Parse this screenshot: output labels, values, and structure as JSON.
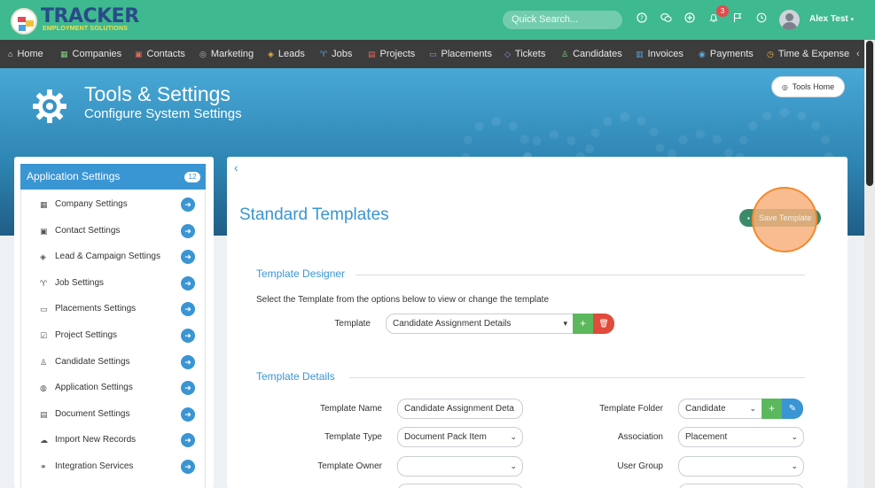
{
  "topbar": {
    "logo_text": "TRACKER",
    "logo_sub": "EMPLOYMENT SOLUTIONS",
    "search_placeholder": "Quick Search...",
    "notification_count": "3",
    "username": "Alex Test",
    "icons": [
      "help-icon",
      "chat-icon",
      "plus-circle-icon",
      "bell-icon",
      "flag-icon",
      "history-icon"
    ]
  },
  "nav": {
    "items": [
      {
        "label": "Home",
        "icon": "home-icon"
      },
      {
        "label": "Companies",
        "icon": "building-icon"
      },
      {
        "label": "Contacts",
        "icon": "contact-icon"
      },
      {
        "label": "Marketing",
        "icon": "broadcast-icon"
      },
      {
        "label": "Leads",
        "icon": "target-icon"
      },
      {
        "label": "Jobs",
        "icon": "trophy-icon"
      },
      {
        "label": "Projects",
        "icon": "folder-icon"
      },
      {
        "label": "Placements",
        "icon": "briefcase-icon"
      },
      {
        "label": "Tickets",
        "icon": "ticket-icon"
      },
      {
        "label": "Candidates",
        "icon": "people-icon"
      },
      {
        "label": "Invoices",
        "icon": "invoice-icon"
      },
      {
        "label": "Payments",
        "icon": "payment-icon"
      },
      {
        "label": "Time & Expense",
        "icon": "clock-icon"
      }
    ]
  },
  "hero": {
    "title": "Tools & Settings",
    "subtitle": "Configure System Settings",
    "tools_home_label": "Tools Home"
  },
  "sidebar": {
    "header": "Application Settings",
    "count": "12",
    "items": [
      {
        "label": "Company Settings",
        "icon": "building-icon"
      },
      {
        "label": "Contact Settings",
        "icon": "contact-card-icon"
      },
      {
        "label": "Lead & Campaign Settings",
        "icon": "target-icon"
      },
      {
        "label": "Job Settings",
        "icon": "trophy-icon"
      },
      {
        "label": "Placements Settings",
        "icon": "briefcase-icon"
      },
      {
        "label": "Project Settings",
        "icon": "checkbox-icon"
      },
      {
        "label": "Candidate Settings",
        "icon": "people-icon"
      },
      {
        "label": "Application Settings",
        "icon": "globe-icon"
      },
      {
        "label": "Document Settings",
        "icon": "document-icon"
      },
      {
        "label": "Import New Records",
        "icon": "cloud-upload-icon"
      },
      {
        "label": "Integration Services",
        "icon": "link-icon"
      }
    ]
  },
  "main": {
    "title": "Standard Templates",
    "save_label": "Save Template",
    "designer": {
      "heading": "Template Designer",
      "description": "Select the Template from the options below to view or change the template",
      "template_label": "Template",
      "template_value": "Candidate Assignment Details"
    },
    "details": {
      "heading": "Template Details",
      "name_label": "Template Name",
      "name_value": "Candidate Assignment Deta",
      "folder_label": "Template Folder",
      "folder_value": "Candidate",
      "type_label": "Template Type",
      "type_value": "Document Pack Item",
      "association_label": "Association",
      "association_value": "Placement",
      "owner_label": "Template Owner",
      "owner_value": "",
      "group_label": "User Group",
      "group_value": ""
    }
  },
  "colors": {
    "topbar": "#3fb98f",
    "navbar": "#3c3c3c",
    "accent": "#3a95d3",
    "highlight": "#f28a2e"
  }
}
